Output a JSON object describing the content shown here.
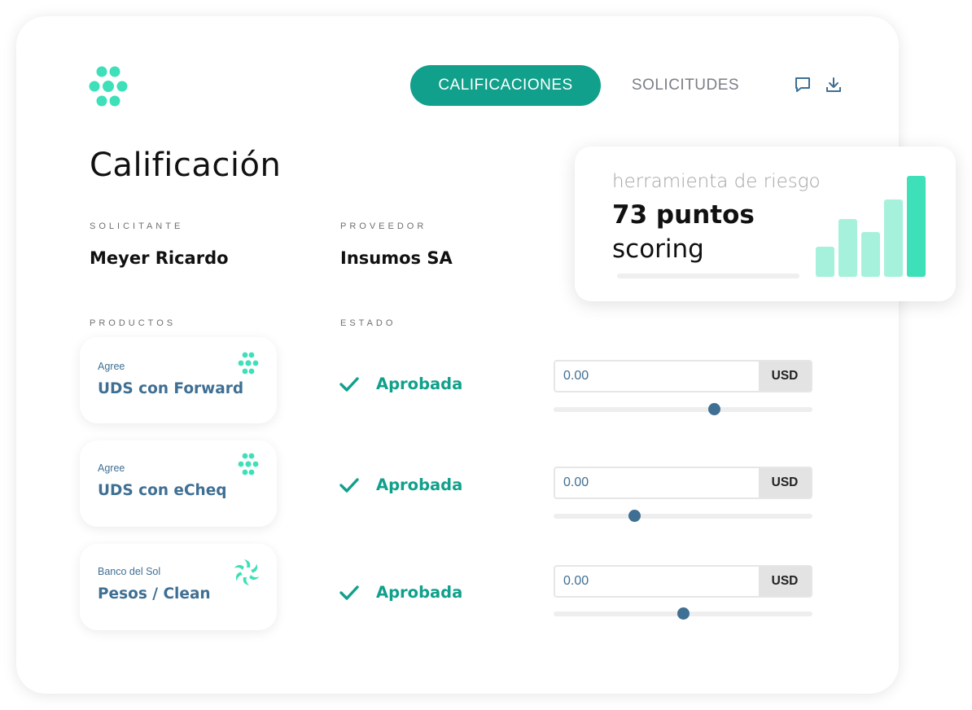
{
  "nav": {
    "tabs": [
      {
        "label": "CALIFICACIONES",
        "active": true
      },
      {
        "label": "SOLICITUDES",
        "active": false
      }
    ],
    "icons": [
      "chat-icon",
      "download-icon"
    ]
  },
  "page": {
    "title": "Calificación",
    "applicant_label": "SOLICITANTE",
    "applicant": "Meyer Ricardo",
    "provider_label": "PROVEEDOR",
    "provider": "Insumos SA",
    "products_label": "PRODUCTOS",
    "status_label": "ESTADO"
  },
  "products": [
    {
      "provider": "Agree",
      "name": "UDS con Forward",
      "icon": "agree-dots-icon",
      "status": "Aprobada",
      "amount": "0.00",
      "currency": "USD",
      "slider_fraction": 0.62
    },
    {
      "provider": "Agree",
      "name": "UDS con eCheq",
      "icon": "agree-dots-icon",
      "status": "Aprobada",
      "amount": "0.00",
      "currency": "USD",
      "slider_fraction": 0.31
    },
    {
      "provider": "Banco del Sol",
      "name": "Pesos / Clean",
      "icon": "sun-swirl-icon",
      "status": "Aprobada",
      "amount": "0.00",
      "currency": "USD",
      "slider_fraction": 0.5
    }
  ],
  "risk": {
    "subtitle": "herramienta de riesgo",
    "points": "73 puntos",
    "label": "scoring",
    "bar_levels": [
      0.3,
      0.57,
      0.44,
      0.77,
      1.0
    ]
  },
  "colors": {
    "accent": "#10a08b",
    "logo": "#3de0b8",
    "product_text": "#3f6f93",
    "bar_light": "#a6f1dc",
    "bar_strong": "#3de0b8"
  }
}
